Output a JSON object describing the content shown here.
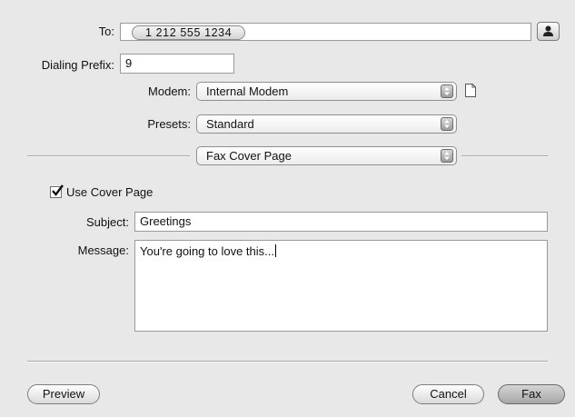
{
  "to": {
    "label": "To:",
    "recipient": "1 212 555 1234"
  },
  "dialing_prefix": {
    "label": "Dialing Prefix:",
    "value": "9"
  },
  "modem": {
    "label": "Modem:",
    "selected": "Internal Modem"
  },
  "presets": {
    "label": "Presets:",
    "selected": "Standard"
  },
  "pane": {
    "selected": "Fax Cover Page"
  },
  "cover_page": {
    "checkbox_label": "Use Cover Page",
    "checked": true,
    "subject_label": "Subject:",
    "subject_value": "Greetings",
    "message_label": "Message:",
    "message_value": "You're going to love this..."
  },
  "buttons": {
    "preview": "Preview",
    "cancel": "Cancel",
    "fax": "Fax"
  },
  "icons": {
    "address_book": "address-book-icon",
    "modem_doc": "document-icon",
    "popup_arrow": "popup-arrows-icon",
    "checkmark": "checkmark-icon"
  }
}
